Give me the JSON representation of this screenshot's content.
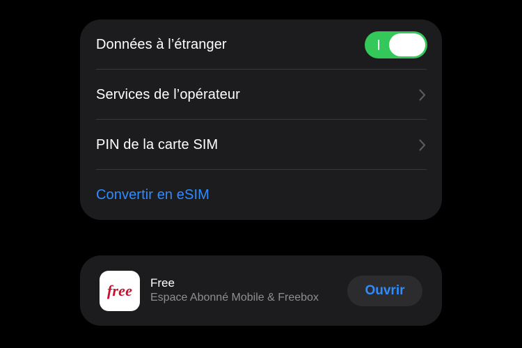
{
  "settings": {
    "rows": [
      {
        "label": "Données à l’étranger",
        "control": "toggle",
        "toggle_on": true
      },
      {
        "label": "Services de l’opérateur",
        "control": "chevron"
      },
      {
        "label": "PIN de la carte SIM",
        "control": "chevron"
      },
      {
        "label": "Convertir en eSIM",
        "control": "link"
      }
    ]
  },
  "app_suggestion": {
    "icon_text": "free",
    "name": "Free",
    "subtitle": "Espace Abonné Mobile & Freebox",
    "button_label": "Ouvrir"
  },
  "colors": {
    "background": "#000000",
    "card": "#1c1c1e",
    "toggle_on": "#34c759",
    "link": "#2f8cff",
    "secondary_text": "#8e8e93",
    "brand_red": "#c8102e"
  }
}
